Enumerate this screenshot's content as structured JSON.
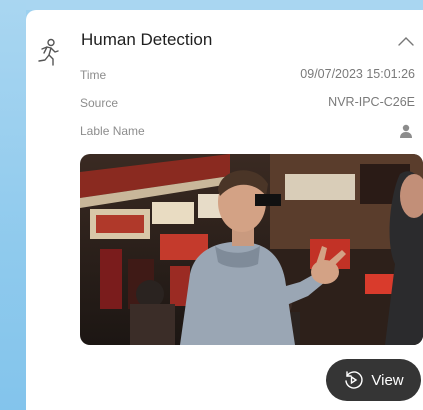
{
  "event": {
    "title": "Human Detection",
    "icon": "running-person-icon",
    "collapse_icon": "chevron-up-icon"
  },
  "details": {
    "time_label": "Time",
    "time_value": "09/07/2023 15:01:26",
    "source_label": "Source",
    "source_value": "NVR-IPC-C26E",
    "label_name_label": "Lable Name",
    "label_name_icon": "user-icon"
  },
  "snapshot": {
    "description_icon": "camera-snapshot-image"
  },
  "actions": {
    "view_label": "View",
    "view_icon": "replay-icon"
  },
  "colors": {
    "background": "#9cd0ef",
    "card": "#ffffff",
    "button": "#353535"
  }
}
